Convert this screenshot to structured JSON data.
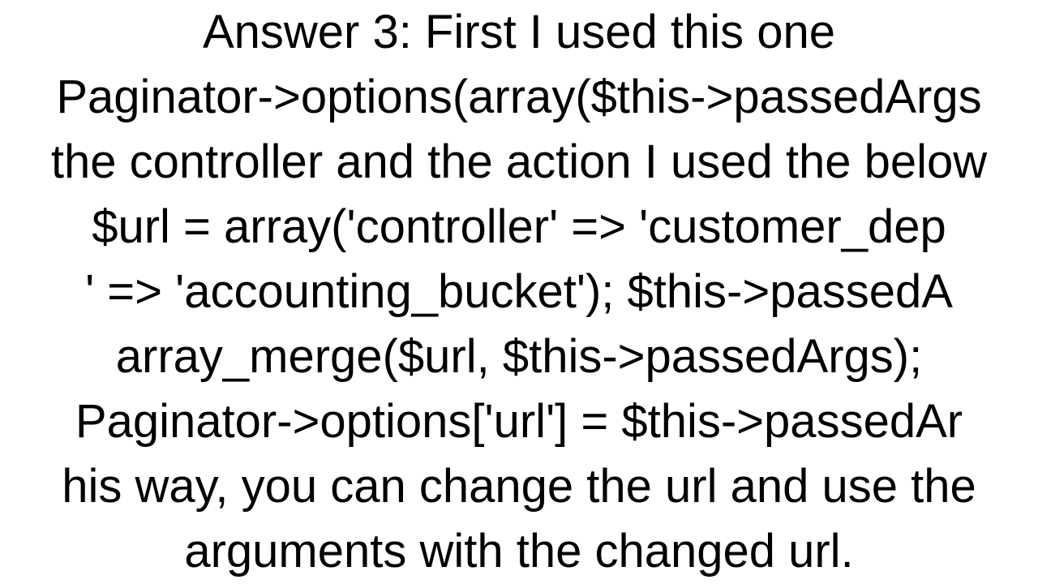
{
  "text": {
    "line1": "Answer 3: First I used this one",
    "line2": "Paginator->options(array($this->passedArgs",
    "line3": "the controller and the action I used the below",
    "line4": "$url = array('controller' => 'customer_dep",
    "line5": "' => 'accounting_bucket');  $this->passedA",
    "line6": "array_merge($url, $this->passedArgs);",
    "line7": "Paginator->options['url'] = $this->passedAr",
    "line8": "his way, you can change the url and use the",
    "line9": "arguments with the changed url."
  }
}
